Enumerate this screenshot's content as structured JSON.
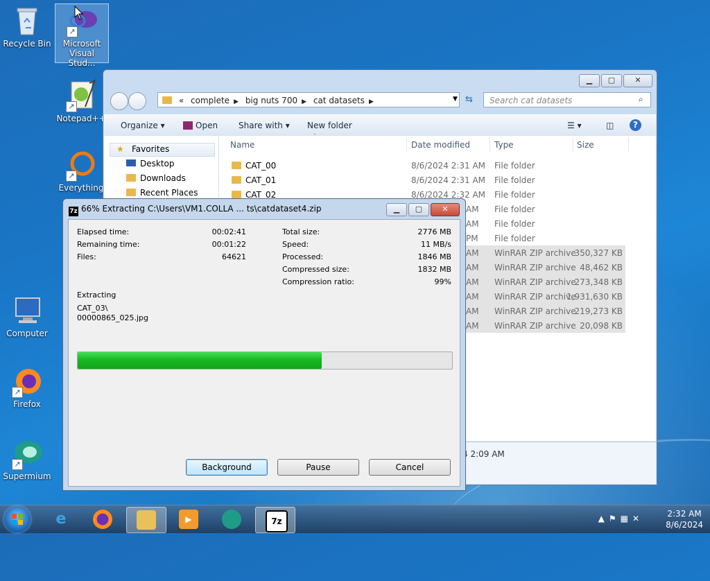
{
  "desktop": {
    "icons": [
      {
        "label": "Recycle Bin"
      },
      {
        "label": "Microsoft Visual Stud..."
      },
      {
        "label": "Notepad++"
      },
      {
        "label": "Everything"
      },
      {
        "label": "Computer"
      },
      {
        "label": "Firefox"
      },
      {
        "label": "Supermium"
      }
    ]
  },
  "explorer": {
    "breadcrumb": [
      "«",
      "complete",
      "big nuts 700",
      "cat datasets"
    ],
    "search_placeholder": "Search cat datasets",
    "toolbar": {
      "organize": "Organize",
      "open": "Open",
      "share_with": "Share with",
      "new_folder": "New folder"
    },
    "nav": [
      "Favorites",
      "Desktop",
      "Downloads",
      "Recent Places"
    ],
    "columns": [
      "Name",
      "Date modified",
      "Type",
      "Size"
    ],
    "rows": [
      {
        "name": "CAT_00",
        "date": "8/6/2024 2:31 AM",
        "type": "File folder",
        "size": ""
      },
      {
        "name": "CAT_01",
        "date": "8/6/2024 2:31 AM",
        "type": "File folder",
        "size": ""
      },
      {
        "name": "CAT_02",
        "date": "8/6/2024 2:32 AM",
        "type": "File folder",
        "size": ""
      },
      {
        "name": "",
        "date": "AM",
        "type": "File folder",
        "size": ""
      },
      {
        "name": "",
        "date": "AM",
        "type": "File folder",
        "size": ""
      },
      {
        "name": "",
        "date": "PM",
        "type": "File folder",
        "size": ""
      },
      {
        "name": "",
        "date": "AM",
        "type": "WinRAR ZIP archive",
        "size": "350,327 KB"
      },
      {
        "name": "",
        "date": "AM",
        "type": "WinRAR ZIP archive",
        "size": "48,462 KB"
      },
      {
        "name": "",
        "date": "AM",
        "type": "WinRAR ZIP archive",
        "size": "273,348 KB"
      },
      {
        "name": "",
        "date": "AM",
        "type": "WinRAR ZIP archive",
        "size": "1,931,630 KB"
      },
      {
        "name": "",
        "date": "AM",
        "type": "WinRAR ZIP archive",
        "size": "219,273 KB"
      },
      {
        "name": "",
        "date": "AM",
        "type": "WinRAR ZIP archive",
        "size": "20,098 KB"
      }
    ],
    "details_text": "4 2:09 AM"
  },
  "dialog": {
    "app_icon": "7z",
    "title": "66% Extracting C:\\Users\\VM1.COLLA ... ts\\catdataset4.zip",
    "left_stats": [
      {
        "label": "Elapsed time:",
        "value": "00:02:41"
      },
      {
        "label": "Remaining time:",
        "value": "00:01:22"
      },
      {
        "label": "Files:",
        "value": "64621"
      }
    ],
    "right_stats": [
      {
        "label": "Total size:",
        "value": "2776 MB"
      },
      {
        "label": "Speed:",
        "value": "11 MB/s"
      },
      {
        "label": "Processed:",
        "value": "1846 MB"
      },
      {
        "label": "Compressed size:",
        "value": "1832 MB"
      },
      {
        "label": "Compression ratio:",
        "value": "99%"
      }
    ],
    "action": "Extracting",
    "current_dir": "CAT_03\\",
    "current_file": "00000865_025.jpg",
    "progress_fraction": 0.652,
    "buttons": {
      "background": "Background",
      "pause": "Pause",
      "cancel": "Cancel"
    }
  },
  "taskbar": {
    "apps": [
      "ie-icon",
      "firefox-icon",
      "explorer-icon",
      "media-player-icon",
      "supermium-icon",
      "7zip-icon"
    ],
    "sevenzip_label": "7z",
    "time": "2:32 AM",
    "date": "8/6/2024"
  }
}
